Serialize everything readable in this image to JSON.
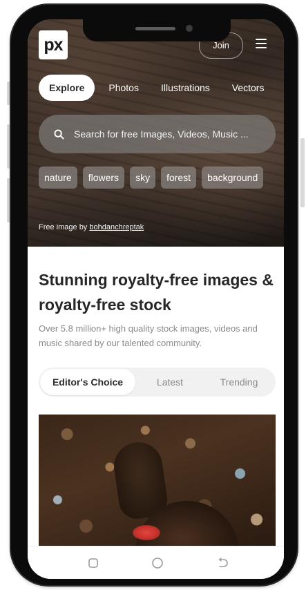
{
  "header": {
    "logo_text": "px",
    "join_label": "Join",
    "menu_icon": "hamburger-menu-icon"
  },
  "tabs": [
    {
      "label": "Explore",
      "active": true
    },
    {
      "label": "Photos",
      "active": false
    },
    {
      "label": "Illustrations",
      "active": false
    },
    {
      "label": "Vectors",
      "active": false
    }
  ],
  "search": {
    "placeholder": "Search for free Images, Videos, Music ...",
    "icon": "search-icon"
  },
  "chips": [
    "nature",
    "flowers",
    "sky",
    "forest",
    "background"
  ],
  "credit": {
    "prefix": "Free image by ",
    "author": "bohdanchreptak"
  },
  "content": {
    "headline": "Stunning royalty-free images & royalty-free stock",
    "subtext": "Over 5.8 million+ high quality stock images, videos and music shared by our talented community."
  },
  "segments": [
    {
      "label": "Editor's Choice",
      "active": true
    },
    {
      "label": "Latest",
      "active": false
    },
    {
      "label": "Trending",
      "active": false
    }
  ],
  "android_nav": {
    "icons": [
      "recent-apps-icon",
      "home-icon",
      "back-icon"
    ]
  },
  "colors": {
    "phone_frame": "#0b0b0b",
    "text_dark": "#262626",
    "text_muted": "#8a8a8a",
    "segment_bg": "#f1f1f1"
  }
}
